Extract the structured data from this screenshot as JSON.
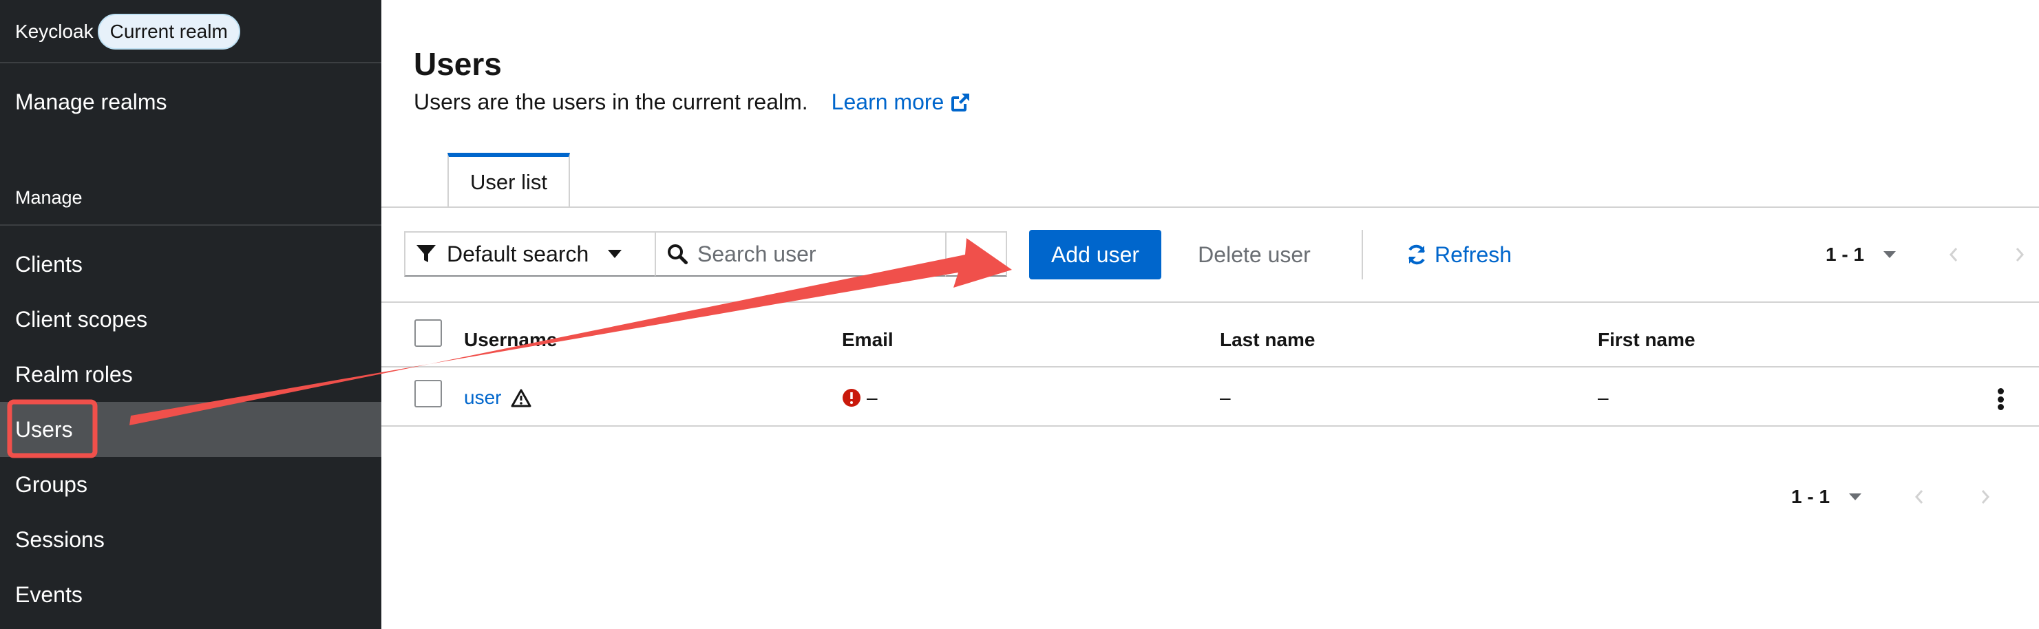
{
  "sidebar": {
    "brand": "Keycloak",
    "realm_badge": "Current realm",
    "manage_realms": "Manage realms",
    "section_label": "Manage",
    "items": [
      {
        "label": "Clients"
      },
      {
        "label": "Client scopes"
      },
      {
        "label": "Realm roles"
      },
      {
        "label": "Users"
      },
      {
        "label": "Groups"
      },
      {
        "label": "Sessions"
      },
      {
        "label": "Events"
      }
    ],
    "active_item": "Users"
  },
  "page": {
    "title": "Users",
    "description": "Users are the users in the current realm.",
    "learn_more": "Learn more"
  },
  "tabs": [
    {
      "label": "User list"
    }
  ],
  "toolbar": {
    "filter_label": "Default search",
    "search_placeholder": "Search user",
    "add_user": "Add user",
    "delete_user": "Delete user",
    "refresh": "Refresh",
    "pagination_top": "1 - 1"
  },
  "table": {
    "columns": [
      "Username",
      "Email",
      "Last name",
      "First name"
    ],
    "rows": [
      {
        "username": "user",
        "email": "–",
        "last_name": "–",
        "first_name": "–"
      }
    ]
  },
  "pagination_bottom": "1 - 1",
  "colors": {
    "sidebar_bg": "#212427",
    "active_item_bg": "#4f5255",
    "primary": "#0066cc",
    "annotation": "#f0504b",
    "error": "#c9190b"
  },
  "icons": [
    "filter-icon",
    "caret-down-icon",
    "search-icon",
    "arrow-right-icon",
    "sync-icon",
    "external-link-icon",
    "warning-triangle-icon",
    "exclamation-circle-icon",
    "kebab-icon",
    "angle-left-icon",
    "angle-right-icon"
  ]
}
